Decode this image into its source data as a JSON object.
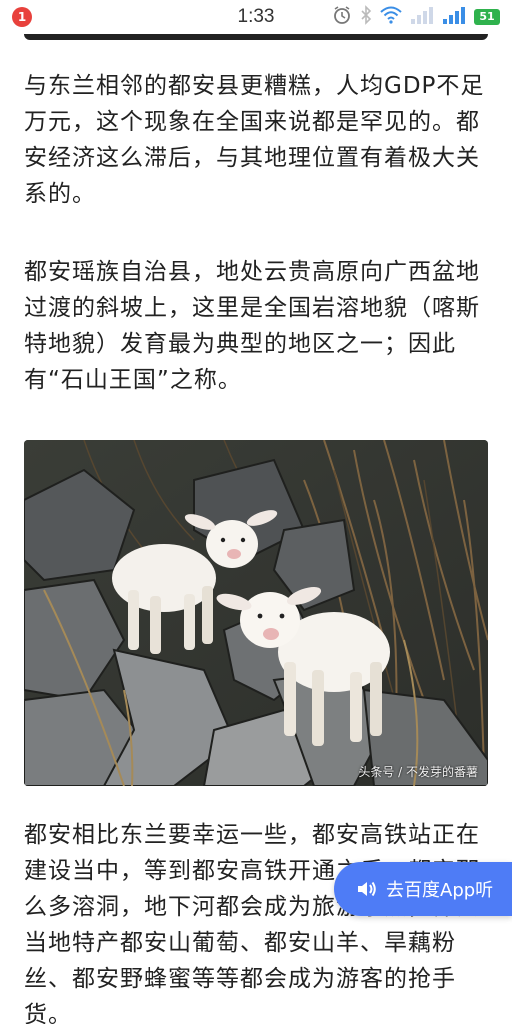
{
  "status_bar": {
    "notification_count": "1",
    "time": "1:33",
    "battery": "51"
  },
  "article": {
    "paragraphs": [
      "与东兰相邻的都安县更糟糕，人均GDP不足万元，这个现象在全国来说都是罕见的。都安经济这么滞后，与其地理位置有着极大关系的。",
      "都安瑶族自治县，地处云贵高原向广西盆地过渡的斜坡上，这里是全国岩溶地貌（喀斯特地貌）发育最为典型的地区之一；因此有“石山王国”之称。",
      "都安相比东兰要幸运一些，都安高铁站正在建设当中，等到都安高铁开通之后，都安那么多溶洞，地下河都会成为旅游景点，都安当地特产都安山葡萄、都安山羊、旱藕粉丝、都安野蜂蜜等等都会成为游客的抢手货。"
    ],
    "image": {
      "subject": "two white baby goats standing on grey karst rocks",
      "watermark": "头条号 / 不发芽的番薯"
    }
  },
  "floating_button": {
    "label": "去百度App听",
    "icon": "speaker-icon",
    "color": "#4e7cf6"
  },
  "icons": [
    "alarm-clock-icon",
    "bluetooth-icon",
    "wifi-icon",
    "signal-icon",
    "signal-icon",
    "battery-icon"
  ]
}
